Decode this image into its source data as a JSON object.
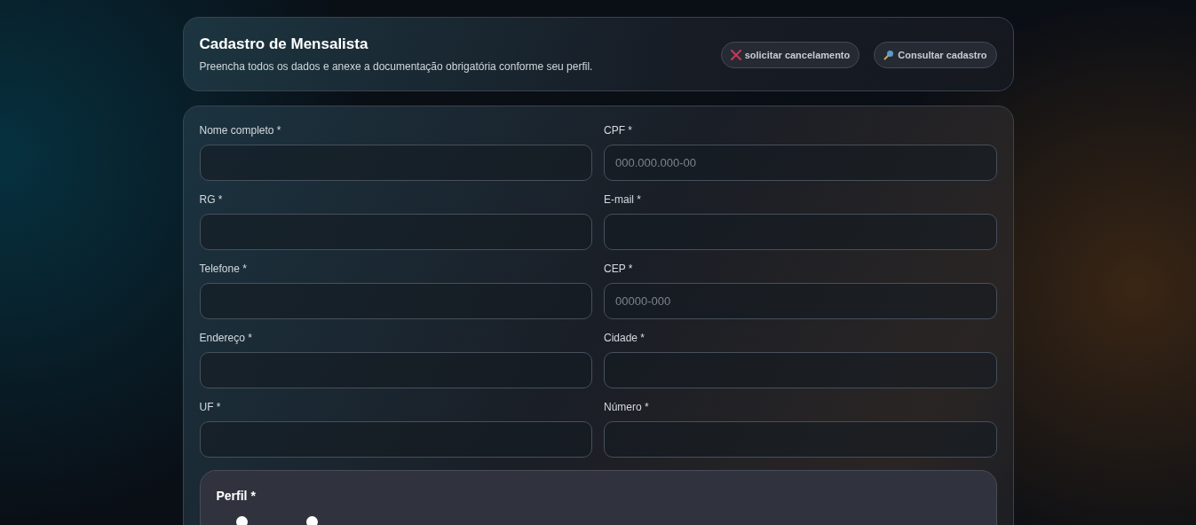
{
  "header": {
    "title": "Cadastro de Mensalista",
    "subtitle": "Preencha todos os dados e anexe a documentação obrigatória conforme seu perfil.",
    "actions": [
      {
        "kind": "cancel",
        "label": "solicitar cancelamento"
      },
      {
        "kind": "search",
        "label": "Consultar cadastro"
      }
    ]
  },
  "fields": [
    {
      "label": "Nome completo *"
    },
    {
      "label": "CPF *",
      "placeholder": "000.000.000-00"
    },
    {
      "label": "RG *"
    },
    {
      "label": "E-mail *"
    },
    {
      "label": "Telefone *"
    },
    {
      "label": "CEP *",
      "placeholder": "00000-000"
    },
    {
      "label": "Endereço *"
    },
    {
      "label": "Cidade *"
    },
    {
      "label": "UF *"
    },
    {
      "label": "Número *"
    }
  ],
  "perfil": {
    "title": "Perfil *",
    "options": [
      {
        "selected": false
      },
      {
        "selected": false
      }
    ]
  }
}
